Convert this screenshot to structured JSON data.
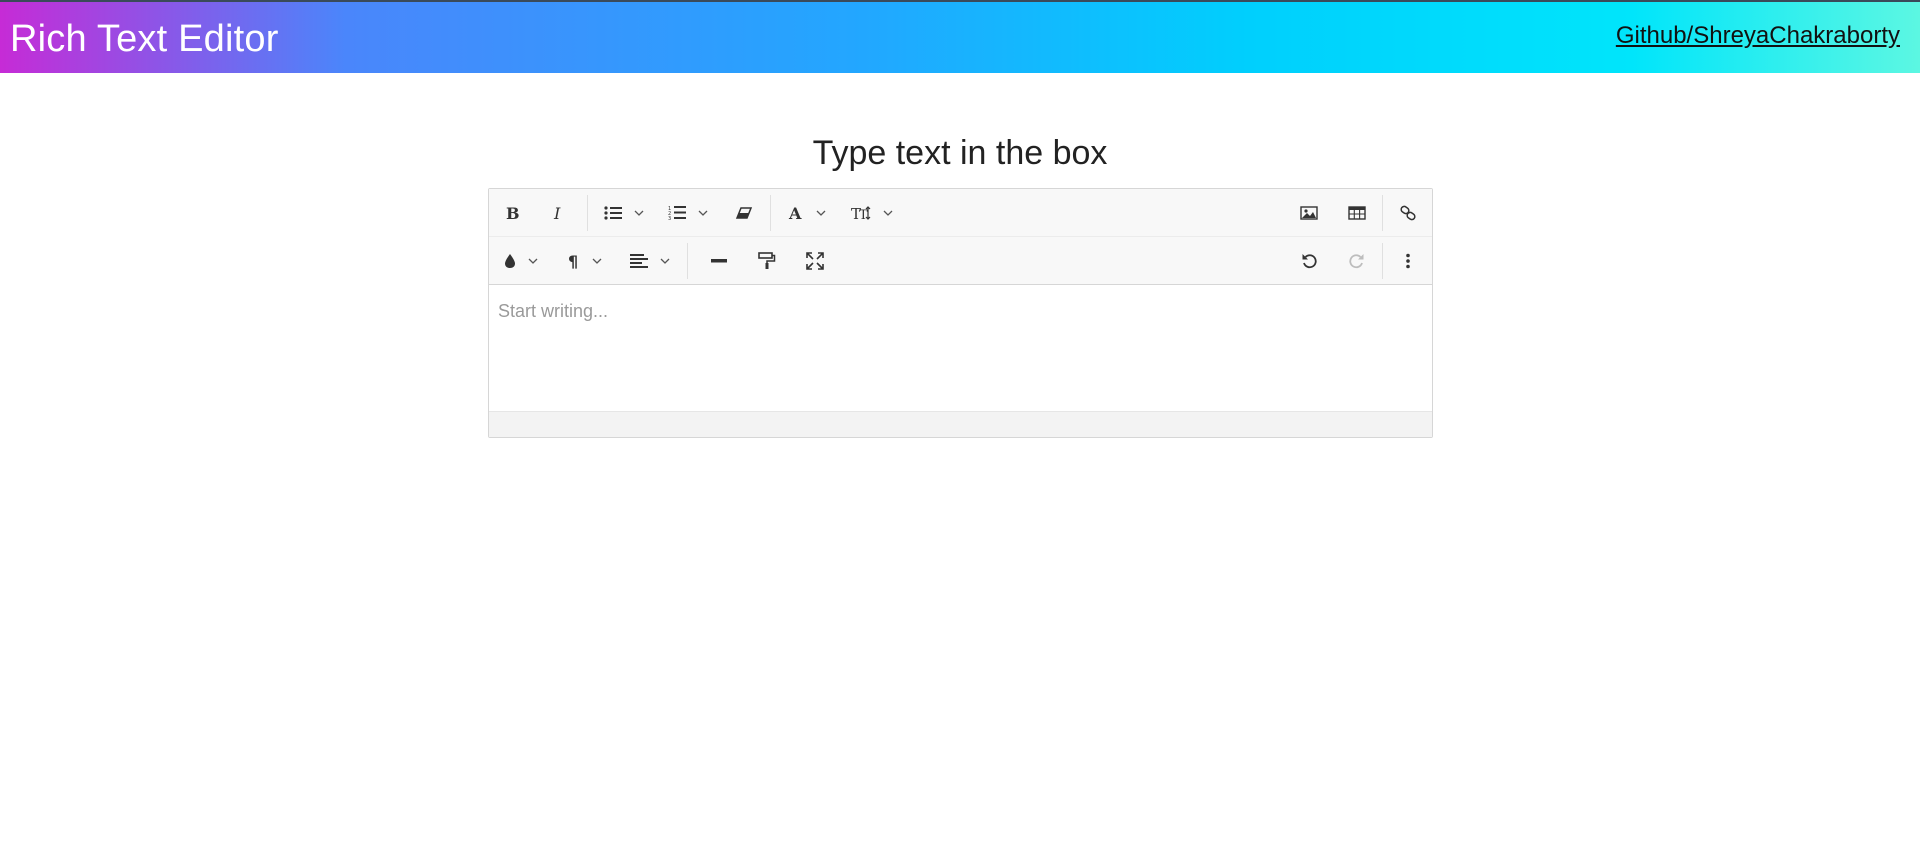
{
  "header": {
    "title": "Rich Text Editor",
    "repo_link": "Github/ShreyaChakraborty",
    "gradient_colors": [
      "#c62bd6",
      "#4a86fb",
      "#00cffd",
      "#00e5fb",
      "#5cf7e2"
    ]
  },
  "page": {
    "heading": "Type text in the box"
  },
  "editor": {
    "placeholder": "Start writing...",
    "toolbar": {
      "row1": [
        {
          "name": "bold",
          "icon": "bold-icon"
        },
        {
          "name": "italic",
          "icon": "italic-icon"
        },
        {
          "name": "bullet-list",
          "icon": "bullet-list-icon",
          "dropdown": true
        },
        {
          "name": "numbered-list",
          "icon": "numbered-list-icon",
          "dropdown": true
        },
        {
          "name": "clear-format",
          "icon": "eraser-icon"
        },
        {
          "name": "font-color",
          "icon": "font-icon",
          "dropdown": true
        },
        {
          "name": "font-size",
          "icon": "text-size-icon",
          "dropdown": true
        },
        {
          "name": "insert-image",
          "icon": "image-icon"
        },
        {
          "name": "insert-table",
          "icon": "table-icon"
        },
        {
          "name": "insert-link",
          "icon": "link-icon"
        }
      ],
      "row2": [
        {
          "name": "highlight-color",
          "icon": "ink-drop-icon",
          "dropdown": true
        },
        {
          "name": "paragraph",
          "icon": "paragraph-icon",
          "dropdown": true
        },
        {
          "name": "align",
          "icon": "align-left-icon",
          "dropdown": true
        },
        {
          "name": "horizontal-rule",
          "icon": "horizontal-rule-icon"
        },
        {
          "name": "format-painter",
          "icon": "paint-roller-icon"
        },
        {
          "name": "fullscreen",
          "icon": "fullscreen-icon"
        },
        {
          "name": "undo",
          "icon": "undo-icon"
        },
        {
          "name": "redo",
          "icon": "redo-icon",
          "disabled": true
        },
        {
          "name": "more",
          "icon": "more-vertical-icon"
        }
      ]
    }
  }
}
